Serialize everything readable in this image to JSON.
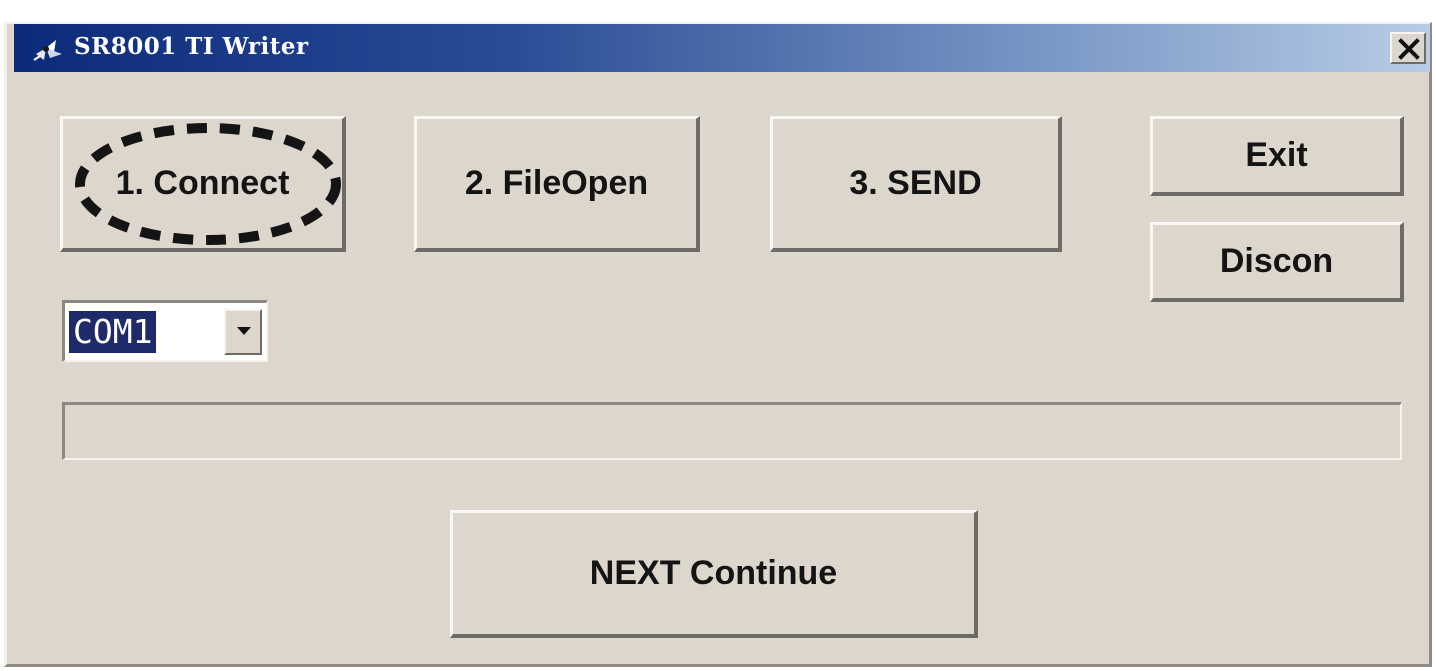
{
  "window": {
    "title": "SR8001 TI Writer",
    "icon": "app-logo-icon",
    "close_icon": "close-icon"
  },
  "buttons": {
    "connect": "1. Connect",
    "file_open": "2. FileOpen",
    "send": "3. SEND",
    "exit": "Exit",
    "discon": "Discon",
    "next_continue": "NEXT Continue"
  },
  "port_select": {
    "selected": "COM1",
    "icon": "chevron-down-icon"
  },
  "progress": {
    "value": 0
  },
  "colors": {
    "title_bar_start": "#0c2a7a",
    "title_bar_end": "#b8cce6",
    "window_face": "#ddd6cc",
    "selection": "#1f2a6a",
    "highlight_outline": "#141414"
  }
}
